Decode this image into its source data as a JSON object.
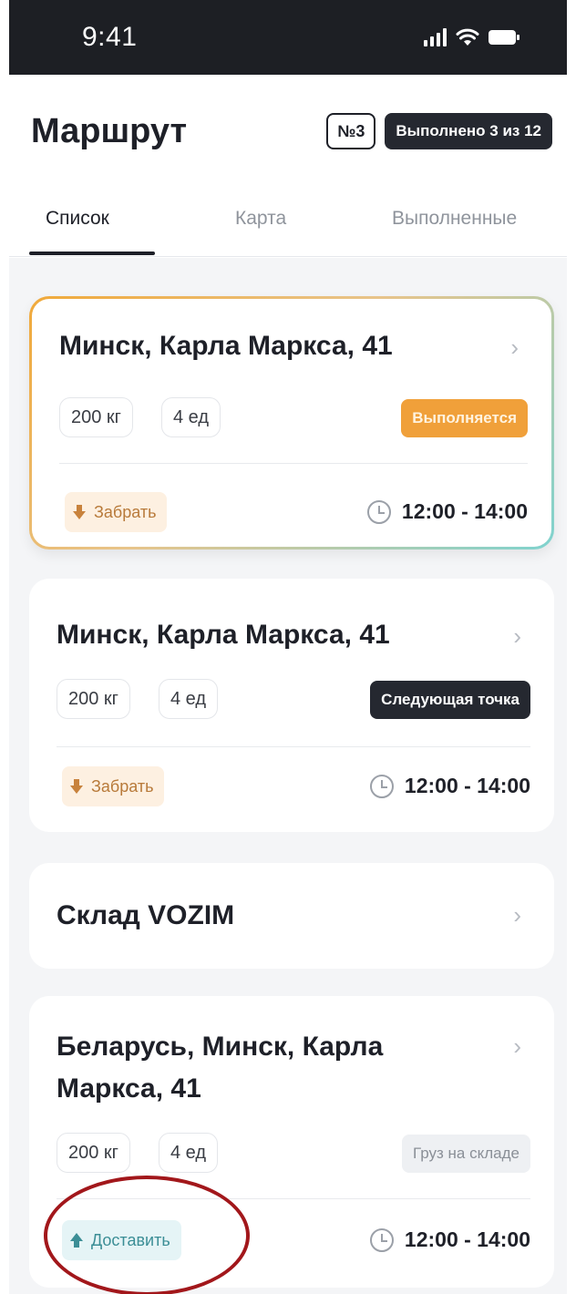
{
  "status_bar": {
    "time": "9:41"
  },
  "header": {
    "title": "Маршрут",
    "route_number": "№3",
    "progress": "Выполнено 3 из 12"
  },
  "tabs": [
    {
      "label": "Список",
      "active": true
    },
    {
      "label": "Карта",
      "active": false
    },
    {
      "label": "Выполненные",
      "active": false
    }
  ],
  "cards": [
    {
      "address": "Минск, Карла Маркса, 41",
      "weight": "200 кг",
      "units": "4 ед",
      "status": "Выполняется",
      "action": "Забрать",
      "time": "12:00 - 14:00"
    },
    {
      "address": "Минск, Карла Маркса, 41",
      "weight": "200 кг",
      "units": "4 ед",
      "status": "Следующая точка",
      "action": "Забрать",
      "time": "12:00 - 14:00"
    },
    {
      "address": "Склад VOZIM"
    },
    {
      "address_line1": "Беларусь, Минск, Карла",
      "address_line2": "Маркса, 41",
      "weight": "200 кг",
      "units": "4 ед",
      "status": "Груз на складе",
      "action": "Доставить",
      "time": "12:00 - 14:00"
    }
  ],
  "colors": {
    "accent_orange": "#f0a03a",
    "dark": "#252830",
    "pickup_bg": "#fdf0e1",
    "deliver_bg": "#e5f4f6",
    "annotation_ring": "#a2171b"
  },
  "icons": [
    "signal-icon",
    "wifi-icon",
    "battery-icon",
    "chevron-right-icon",
    "clock-icon",
    "pickup-arrow-icon",
    "deliver-arrow-icon"
  ]
}
